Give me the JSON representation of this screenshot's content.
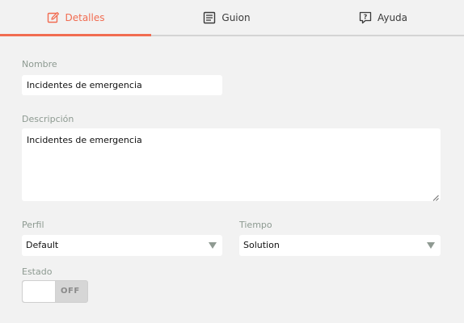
{
  "tabs": [
    {
      "label": "Detalles",
      "icon": "edit-icon",
      "active": true
    },
    {
      "label": "Guion",
      "icon": "document-icon",
      "active": false
    },
    {
      "label": "Ayuda",
      "icon": "help-chat-icon",
      "active": false
    }
  ],
  "form": {
    "nombre_label": "Nombre",
    "nombre_value": "Incidentes de emergencia",
    "descripcion_label": "Descripción",
    "descripcion_value": "Incidentes de emergencia",
    "perfil_label": "Perfil",
    "perfil_value": "Default",
    "tiempo_label": "Tiempo",
    "tiempo_value": "Solution",
    "estado_label": "Estado",
    "estado_toggle_text": "OFF"
  },
  "colors": {
    "accent": "#f16c51",
    "label": "#8d9a91",
    "background": "#f2f2f2"
  }
}
